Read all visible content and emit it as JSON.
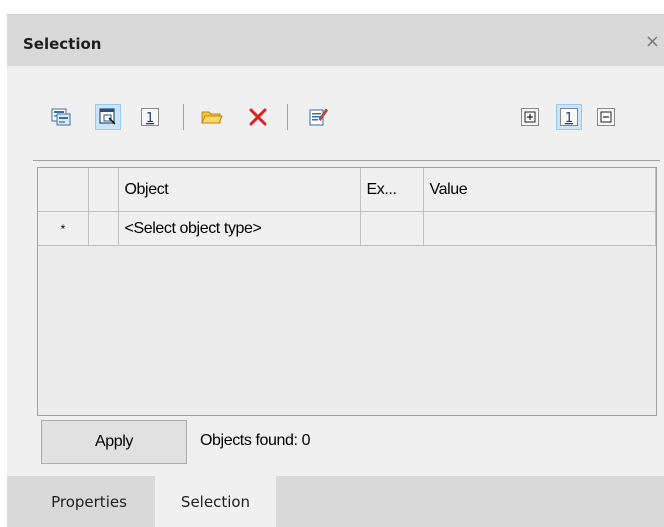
{
  "window": {
    "title": "Selection",
    "close_glyph": "×"
  },
  "toolbar": {
    "left_buttons": [
      {
        "icon": "select-objects-icon",
        "active": false
      },
      {
        "icon": "select-window-icon",
        "active": true
      },
      {
        "icon": "select-one-icon",
        "active": false,
        "glyph": "1"
      }
    ],
    "mid_buttons": [
      {
        "icon": "open-folder-icon"
      },
      {
        "icon": "delete-icon"
      }
    ],
    "properties_button": {
      "icon": "edit-properties-icon"
    },
    "right_buttons": [
      {
        "icon": "expand-icon",
        "active": false
      },
      {
        "icon": "single-level-icon",
        "active": true,
        "glyph": "1"
      },
      {
        "icon": "collapse-icon",
        "active": false
      }
    ]
  },
  "grid": {
    "columns": [
      "",
      "",
      "Object",
      "Ex...",
      "Value"
    ],
    "rows": [
      {
        "marker": "*",
        "object": "<Select object type>",
        "ex": "",
        "value": ""
      }
    ]
  },
  "footer": {
    "apply_label": "Apply",
    "found_text": "Objects found: 0"
  },
  "tabs": [
    {
      "label": "Properties",
      "active": false
    },
    {
      "label": "Selection",
      "active": true
    }
  ],
  "colors": {
    "titlebar": "#d9d9d9",
    "panel": "#f0f0f0",
    "active_button": "#cce4f7",
    "delete_red": "#e02020",
    "folder_yellow": "#f5c542"
  }
}
